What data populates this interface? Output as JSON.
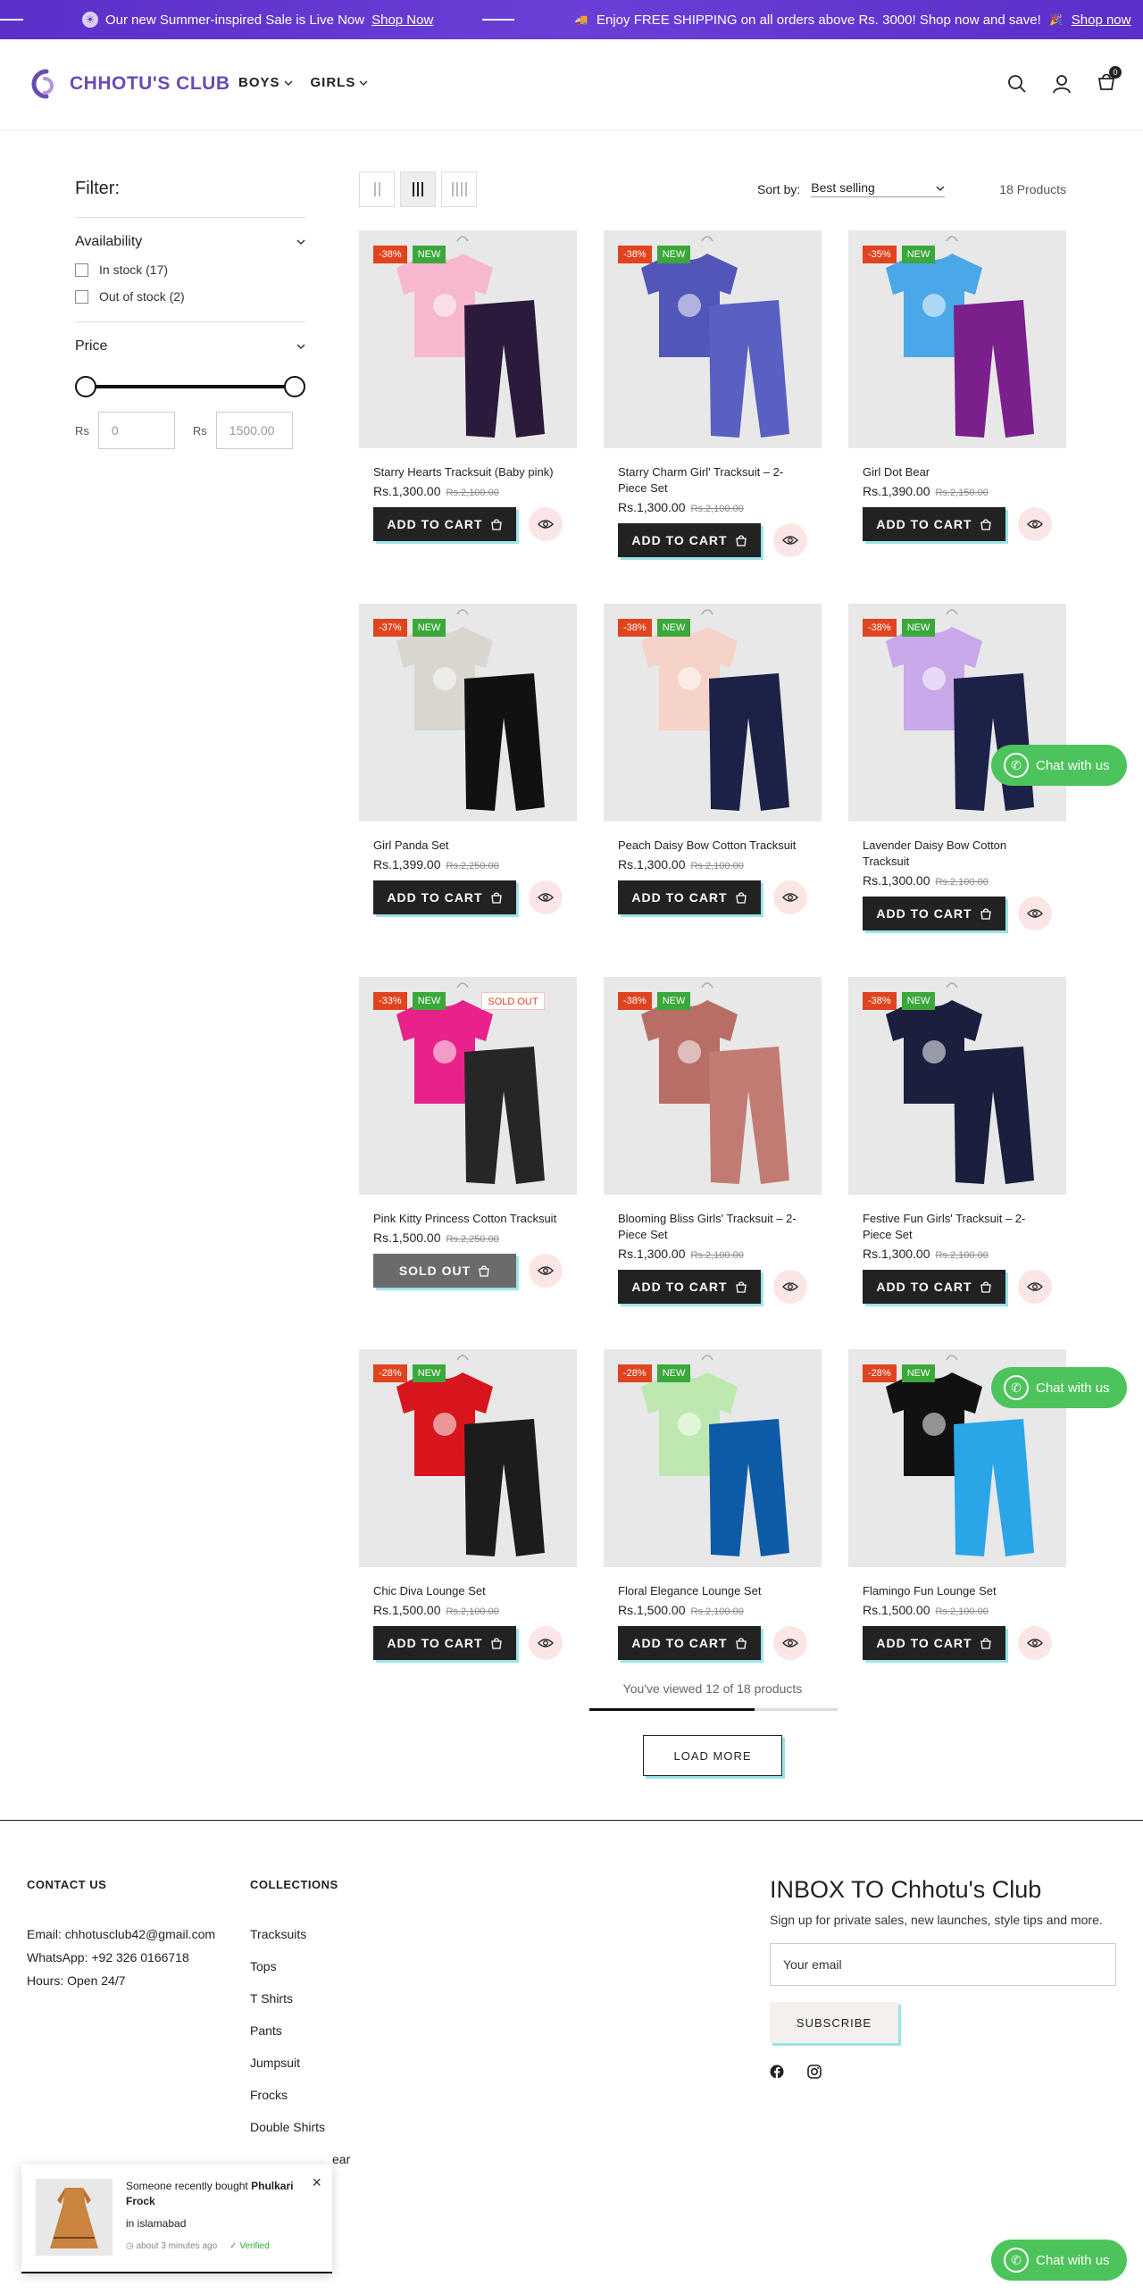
{
  "announcement": {
    "msg1": "Our new Summer-inspired Sale is Live Now",
    "link1": "Shop Now",
    "msg2": "Enjoy FREE SHIPPING on all orders above Rs. 3000! Shop now and save!",
    "link2": "Shop now",
    "bg_color": "#5b2fc9"
  },
  "header": {
    "logo_text": "CHHOTU'S CLUB",
    "nav": [
      "BOYS",
      "GIRLS"
    ],
    "cart_count": "0",
    "icons": [
      "search-icon",
      "account-icon",
      "cart-icon"
    ]
  },
  "filter": {
    "title": "Filter:",
    "availability": {
      "label": "Availability",
      "options": [
        {
          "label": "In stock (17)"
        },
        {
          "label": "Out of stock (2)"
        }
      ]
    },
    "price": {
      "label": "Price",
      "currency": "Rs",
      "min_placeholder": "0",
      "max_placeholder": "1500.00"
    }
  },
  "toolbar": {
    "sort_label": "Sort by:",
    "sort_value": "Best selling",
    "product_count": "18 Products",
    "active_view": 1
  },
  "products": [
    {
      "title": "Starry Hearts Tracksuit (Baby pink)",
      "price": "Rs.1,300.00",
      "old": "Rs.2,100.00",
      "discount": "-38%",
      "new": "NEW",
      "sold_out": "",
      "button": "ADD TO CART",
      "shirt": "#f7b7cf",
      "pants": "#2b1a3a"
    },
    {
      "title": "Starry Charm Girl' Tracksuit – 2-Piece Set",
      "price": "Rs.1,300.00",
      "old": "Rs.2,100.00",
      "discount": "-38%",
      "new": "NEW",
      "sold_out": "",
      "button": "ADD TO CART",
      "shirt": "#5156b8",
      "pants": "#5a5fc2"
    },
    {
      "title": "Girl Dot Bear",
      "price": "Rs.1,390.00",
      "old": "Rs.2,150.00",
      "discount": "-35%",
      "new": "NEW",
      "sold_out": "",
      "button": "ADD TO CART",
      "shirt": "#4aa8e8",
      "pants": "#7a1f8c"
    },
    {
      "title": "Girl Panda Set",
      "price": "Rs.1,399.00",
      "old": "Rs.2,250.00",
      "discount": "-37%",
      "new": "NEW",
      "sold_out": "",
      "button": "ADD TO CART",
      "shirt": "#d9d6cf",
      "pants": "#111111"
    },
    {
      "title": "Peach Daisy Bow Cotton Tracksuit",
      "price": "Rs.1,300.00",
      "old": "Rs.2,100.00",
      "discount": "-38%",
      "new": "NEW",
      "sold_out": "",
      "button": "ADD TO CART",
      "shirt": "#f6d3c8",
      "pants": "#1c2147"
    },
    {
      "title": "Lavender Daisy Bow Cotton Tracksuit",
      "price": "Rs.1,300.00",
      "old": "Rs.2,100.00",
      "discount": "-38%",
      "new": "NEW",
      "sold_out": "",
      "button": "ADD TO CART",
      "shirt": "#c9a8ea",
      "pants": "#1c2147"
    },
    {
      "title": "Pink Kitty Princess Cotton Tracksuit",
      "price": "Rs.1,500.00",
      "old": "Rs.2,250.00",
      "discount": "-33%",
      "new": "NEW",
      "sold_out": "SOLD OUT",
      "button": "SOLD OUT",
      "shirt": "#e8228a",
      "pants": "#262626"
    },
    {
      "title": "Blooming Bliss Girls' Tracksuit – 2-Piece Set",
      "price": "Rs.1,300.00",
      "old": "Rs.2,100.00",
      "discount": "-38%",
      "new": "NEW",
      "sold_out": "",
      "button": "ADD TO CART",
      "shirt": "#b86e66",
      "pants": "#c27b73"
    },
    {
      "title": "Festive Fun Girls' Tracksuit – 2-Piece Set",
      "price": "Rs.1,300.00",
      "old": "Rs.2,100.00",
      "discount": "-38%",
      "new": "NEW",
      "sold_out": "",
      "button": "ADD TO CART",
      "shirt": "#1a1f3d",
      "pants": "#1a1f3d"
    },
    {
      "title": "Chic Diva Lounge Set",
      "price": "Rs.1,500.00",
      "old": "Rs.2,100.00",
      "discount": "-28%",
      "new": "NEW",
      "sold_out": "",
      "button": "ADD TO CART",
      "shirt": "#d8141d",
      "pants": "#1c1c1c"
    },
    {
      "title": "Floral Elegance Lounge Set",
      "price": "Rs.1,500.00",
      "old": "Rs.2,100.00",
      "discount": "-28%",
      "new": "NEW",
      "sold_out": "",
      "button": "ADD TO CART",
      "shirt": "#bfe8b0",
      "pants": "#0d5aa7"
    },
    {
      "title": "Flamingo Fun Lounge Set",
      "price": "Rs.1,500.00",
      "old": "Rs.2,100.00",
      "discount": "-28%",
      "new": "NEW",
      "sold_out": "",
      "button": "ADD TO CART",
      "shirt": "#111111",
      "pants": "#2aa6e8"
    }
  ],
  "pagination": {
    "viewed_text": "You've viewed 12 of 18 products",
    "progress": 0.667,
    "load_more": "LOAD MORE"
  },
  "chat": {
    "label": "Chat with us"
  },
  "footer": {
    "contact": {
      "heading": "CONTACT US",
      "email": "Email: chhotusclub42@gmail.com",
      "whatsapp": "WhatsApp: +92 326 0166718",
      "hours": "Hours: Open 24/7"
    },
    "collections": {
      "heading": "COLLECTIONS",
      "links": [
        "Tracksuits",
        "Tops",
        "T Shirts",
        "Pants",
        "Jumpsuit",
        "Frocks",
        "Double Shirts",
        "ear"
      ]
    },
    "newsletter": {
      "heading": "INBOX TO Chhotu's Club",
      "subtext": "Sign up for private sales, new launches, style tips and more.",
      "email_placeholder": "Your email",
      "button": "SUBSCRIBE"
    },
    "socials": [
      "facebook-icon",
      "instagram-icon"
    ]
  },
  "popup": {
    "prefix": "Someone recently bought",
    "product": "Phulkari Frock",
    "location": "in islamabad",
    "time": "about 3 minutes ago",
    "verified": "Verified"
  }
}
